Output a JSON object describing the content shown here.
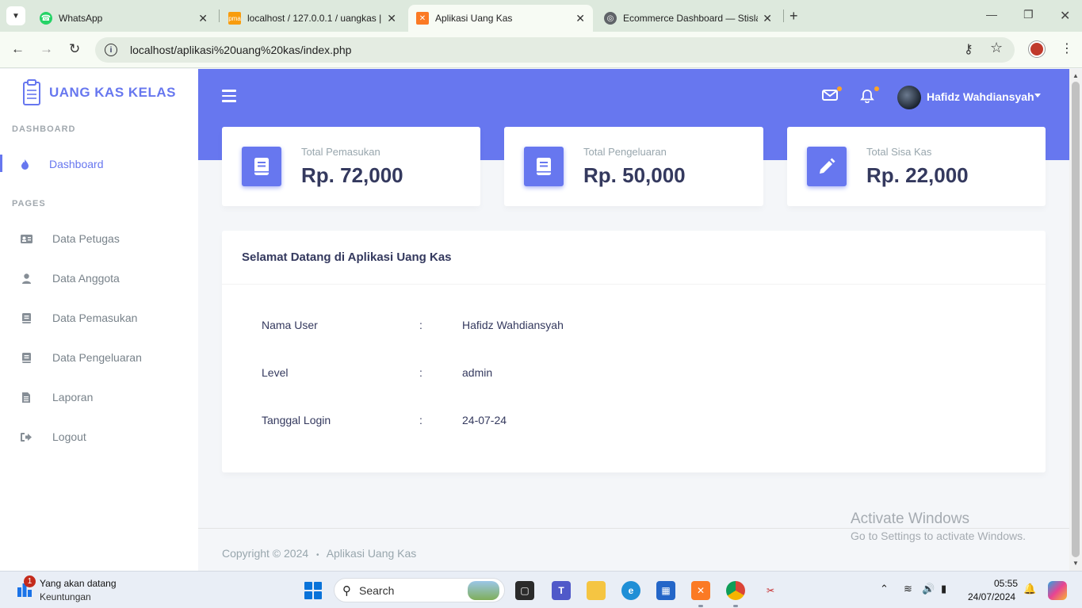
{
  "browser": {
    "tabs": [
      {
        "title": "WhatsApp",
        "icon": "whatsapp-icon"
      },
      {
        "title": "localhost / 127.0.0.1 / uangkas |",
        "icon": "phpmyadmin-icon"
      },
      {
        "title": "Aplikasi Uang Kas",
        "icon": "xampp-icon"
      },
      {
        "title": "Ecommerce Dashboard — Stisla",
        "icon": "globe-icon"
      }
    ],
    "url": "localhost/aplikasi%20uang%20kas/index.php"
  },
  "app": {
    "brand": "UANG KAS KELAS",
    "accent_color": "#6777ef",
    "sidebar": {
      "header_dashboard": "DASHBOARD",
      "header_pages": "PAGES",
      "dashboard_label": "Dashboard",
      "pages": [
        {
          "label": "Data Petugas",
          "icon": "id-card-icon"
        },
        {
          "label": "Data Anggota",
          "icon": "user-icon"
        },
        {
          "label": "Data Pemasukan",
          "icon": "book-icon"
        },
        {
          "label": "Data Pengeluaran",
          "icon": "book-icon"
        },
        {
          "label": "Laporan",
          "icon": "file-icon"
        },
        {
          "label": "Logout",
          "icon": "sign-out-icon"
        }
      ]
    },
    "topbar": {
      "user_name": "Hafidz Wahdiansyah"
    },
    "stats": [
      {
        "title": "Total Pemasukan",
        "value": "Rp. 72,000",
        "icon": "book-icon"
      },
      {
        "title": "Total Pengeluaran",
        "value": "Rp. 50,000",
        "icon": "book-icon"
      },
      {
        "title": "Total Sisa Kas",
        "value": "Rp. 22,000",
        "icon": "pencil-icon"
      }
    ],
    "welcome": {
      "title": "Selamat Datang di Aplikasi Uang Kas",
      "rows": [
        {
          "label": "Nama User",
          "colon": ":",
          "value": "Hafidz Wahdiansyah"
        },
        {
          "label": "Level",
          "colon": ":",
          "value": "admin"
        },
        {
          "label": "Tanggal Login",
          "colon": ":",
          "value": "24-07-24"
        }
      ]
    },
    "footer": {
      "copyright": "Copyright © 2024",
      "bullet": "•",
      "app_name": "Aplikasi Uang Kas"
    }
  },
  "watermark": {
    "line1": "Activate Windows",
    "line2": "Go to Settings to activate Windows."
  },
  "taskbar": {
    "news_badge": "1",
    "news_title": "Yang akan datang",
    "news_subtitle": "Keuntungan",
    "search_label": "Search",
    "time": "05:55",
    "date": "24/07/2024"
  }
}
